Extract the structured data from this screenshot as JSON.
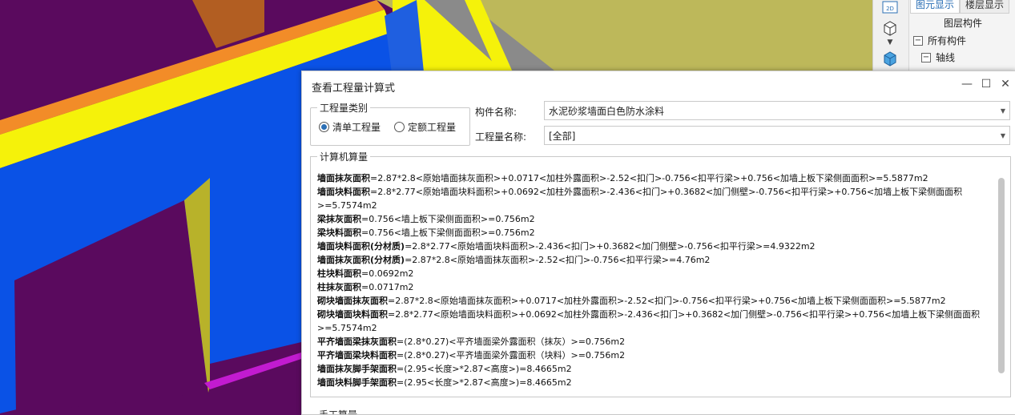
{
  "colors": {
    "purple": "#5a0a5e",
    "blue": "#0a52e6",
    "yellow": "#f5f20a",
    "olive": "#bdb85a",
    "orange": "#f28c28",
    "accent": "#2b6fb5"
  },
  "right_panel": {
    "tabs": [
      "图元显示",
      "楼层显示"
    ],
    "title": "图层构件",
    "tree": [
      {
        "label": "所有构件",
        "toggle": "−"
      },
      {
        "label": "轴线",
        "toggle": "−"
      }
    ],
    "tool_icons": [
      "2d-view-icon",
      "3d-box-icon",
      "dropdown-icon",
      "3d-solid-icon"
    ],
    "btn_2d": "2D"
  },
  "dialog": {
    "title": "查看工程量计算式",
    "controls": [
      "—",
      "☐",
      "✕"
    ],
    "qty_group": {
      "legend": "工程量类别",
      "options": [
        {
          "label": "清单工程量",
          "selected": true
        },
        {
          "label": "定额工程量",
          "selected": false
        }
      ]
    },
    "component_label": "构件名称:",
    "component_value": "水泥砂浆墙面白色防水涂料",
    "qty_name_label": "工程量名称:",
    "qty_name_value": "[全部]",
    "calc_legend": "计算机算量",
    "lines": [
      {
        "name": "墙面抹灰面积",
        "expr": "=2.87*2.8<原始墙面抹灰面积>+0.0717<加柱外露面积>-2.52<扣门>-0.756<扣平行梁>+0.756<加墙上板下梁侧面面积>=5.5877m2"
      },
      {
        "name": "墙面块料面积",
        "expr": "=2.8*2.77<原始墙面块料面积>+0.0692<加柱外露面积>-2.436<扣门>+0.3682<加门侧壁>-0.756<扣平行梁>+0.756<加墙上板下梁侧面面积>=5.7574m2"
      },
      {
        "name": "梁抹灰面积",
        "expr": "=0.756<墙上板下梁侧面面积>=0.756m2"
      },
      {
        "name": "梁块料面积",
        "expr": "=0.756<墙上板下梁侧面面积>=0.756m2"
      },
      {
        "name": "墙面块料面积(分材质)",
        "expr": "=2.8*2.77<原始墙面块料面积>-2.436<扣门>+0.3682<加门侧壁>-0.756<扣平行梁>=4.9322m2"
      },
      {
        "name": "墙面抹灰面积(分材质)",
        "expr": "=2.87*2.8<原始墙面抹灰面积>-2.52<扣门>-0.756<扣平行梁>=4.76m2"
      },
      {
        "name": "柱块料面积",
        "expr": "=0.0692m2"
      },
      {
        "name": "柱抹灰面积",
        "expr": "=0.0717m2"
      },
      {
        "name": "砌块墙面抹灰面积",
        "expr": "=2.87*2.8<原始墙面抹灰面积>+0.0717<加柱外露面积>-2.52<扣门>-0.756<扣平行梁>+0.756<加墙上板下梁侧面面积>=5.5877m2"
      },
      {
        "name": "砌块墙面块料面积",
        "expr": "=2.8*2.77<原始墙面块料面积>+0.0692<加柱外露面积>-2.436<扣门>+0.3682<加门侧壁>-0.756<扣平行梁>+0.756<加墙上板下梁侧面面积>=5.7574m2"
      },
      {
        "name": "平齐墙面梁抹灰面积",
        "expr": "=(2.8*0.27)<平齐墙面梁外露面积（抹灰）>=0.756m2"
      },
      {
        "name": "平齐墙面梁块料面积",
        "expr": "=(2.8*0.27)<平齐墙面梁外露面积（块料）>=0.756m2"
      },
      {
        "name": "墙面抹灰脚手架面积",
        "expr": "=(2.95<长度>*2.87<高度>)=8.4665m2"
      },
      {
        "name": "墙面块料脚手架面积",
        "expr": "=(2.95<长度>*2.87<高度>)=8.4665m2"
      }
    ],
    "manual_legend": "手工算量"
  }
}
